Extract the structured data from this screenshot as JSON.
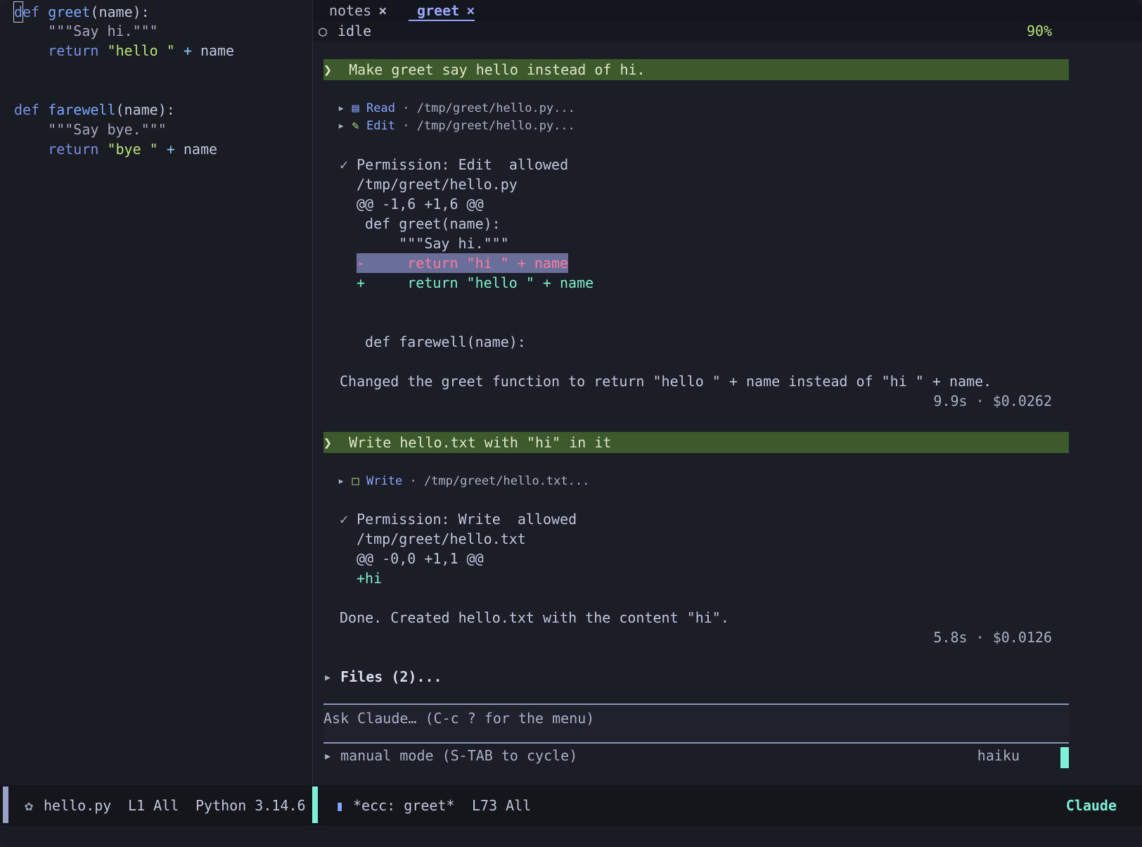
{
  "editor": {
    "filename": "hello.py",
    "lines": {
      "l1_kw_first": "d",
      "l1_kw_rest": "ef",
      "l1_fn": "greet",
      "l1_rest": "(name):",
      "l2_doc": "\"\"\"Say hi.\"\"\"",
      "l3_kw": "return",
      "l3_str": "\"hello \"",
      "l3_op": "+",
      "l3_var": "name",
      "l6_kw": "def",
      "l6_fn": "farewell",
      "l6_rest": "(name):",
      "l7_doc": "\"\"\"Say bye.\"\"\"",
      "l8_kw": "return",
      "l8_str": "\"bye \"",
      "l8_op": "+",
      "l8_var": "name"
    }
  },
  "tabs": [
    {
      "label": "notes",
      "close": "×"
    },
    {
      "label": "greet",
      "close": "×"
    }
  ],
  "session": {
    "status_icon": "○",
    "status": "idle",
    "percent": "90%"
  },
  "turn1": {
    "prompt_marker": "❯",
    "prompt": "Make greet say hello instead of hi.",
    "tools": [
      {
        "arrow": "▸",
        "name": "Read",
        "sep": "·",
        "path": "/tmp/greet/hello.py..."
      },
      {
        "arrow": "▸",
        "name": "Edit",
        "sep": "·",
        "path": "/tmp/greet/hello.py..."
      }
    ],
    "permission": {
      "check": "✓",
      "text": "Permission: Edit  allowed",
      "path": "/tmp/greet/hello.py",
      "hunk": "@@ -1,6 +1,6 @@",
      "ctx1": " def greet(name):",
      "ctx2": "     \"\"\"Say hi.\"\"\"",
      "del": "-     return \"hi \" + name",
      "add": "+     return \"hello \" + name",
      "ctx3": " def farewell(name):"
    },
    "reply": "Changed the greet function to return \"hello \" + name instead of \"hi \" + name.",
    "stats": "9.9s · $0.0262"
  },
  "turn2": {
    "prompt_marker": "❯",
    "prompt": "Write hello.txt with \"hi\" in it",
    "tools": [
      {
        "arrow": "▸",
        "name": "Write",
        "sep": "·",
        "path": "/tmp/greet/hello.txt..."
      }
    ],
    "permission": {
      "check": "✓",
      "text": "Permission: Write  allowed",
      "path": "/tmp/greet/hello.txt",
      "hunk": "@@ -0,0 +1,1 @@",
      "add": "+hi"
    },
    "reply": "Done. Created hello.txt with the content \"hi\".",
    "stats": "5.8s · $0.0126"
  },
  "files": {
    "arrow": "▸",
    "label": "Files (2)..."
  },
  "input": {
    "placeholder": "Ask Claude… (C-c ? for the menu)"
  },
  "mode": {
    "arrow": "▸",
    "label": "manual mode (S-TAB to cycle)",
    "model": "haiku"
  },
  "modeline": {
    "left_file": "hello.py",
    "left_pos": "L1 All",
    "left_mode": "Python 3.14.6",
    "right_buffer": "*ecc: greet*",
    "right_pos": "L73 All",
    "right_mode": "Claude"
  },
  "colors": {
    "prompt_bg": "#3d5a2c",
    "accent_teal": "#7ef0d8",
    "link_blue": "#8aa4ff"
  }
}
